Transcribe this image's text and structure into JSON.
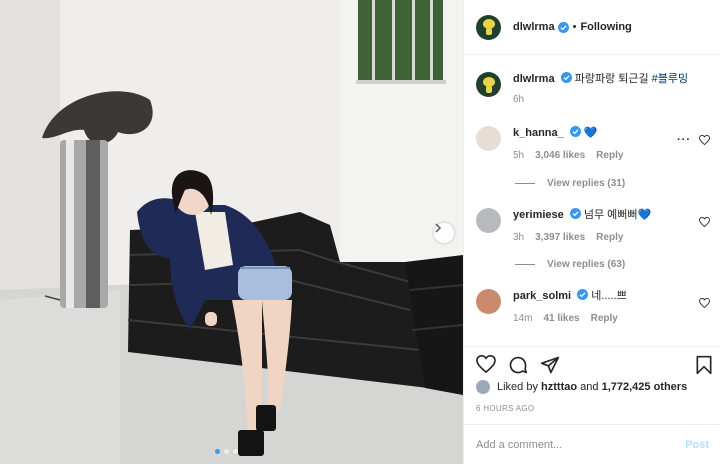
{
  "post": {
    "username": "dlwlrma",
    "following_label": "Following",
    "caption_text": "파랑파랑 퇴근길",
    "caption_hashtag": "#블루밍",
    "caption_time": "6h"
  },
  "comments": [
    {
      "username": "k_hanna_",
      "text": "💙",
      "time": "5h",
      "likes": "3,046 likes",
      "reply": "Reply",
      "view_replies": "View replies (31)"
    },
    {
      "username": "yerimiese",
      "text": "넘무 예뻐뻐💙",
      "time": "3h",
      "likes": "3,397 likes",
      "reply": "Reply",
      "view_replies": "View replies (63)"
    },
    {
      "username": "park_solmi",
      "text": "네.....쁘",
      "time": "14m",
      "likes": "41 likes",
      "reply": "Reply"
    }
  ],
  "likes": {
    "prefix": "Liked by",
    "user": "hztttao",
    "and": "and",
    "others": "1,772,425 others"
  },
  "timestamp": "6 HOURS AGO",
  "add_comment": {
    "placeholder": "Add a comment...",
    "post_label": "Post"
  },
  "carousel": {
    "slides": 3,
    "active": 1
  },
  "icons": [
    "verified-badge-icon",
    "heart-icon",
    "comment-icon",
    "share-icon",
    "bookmark-icon",
    "more-icon",
    "chevron-right-icon"
  ],
  "colors": {
    "verified": "#3897f0",
    "link": "#003569",
    "muted": "#8e8e8e",
    "post_disabled": "#b2dffc"
  }
}
